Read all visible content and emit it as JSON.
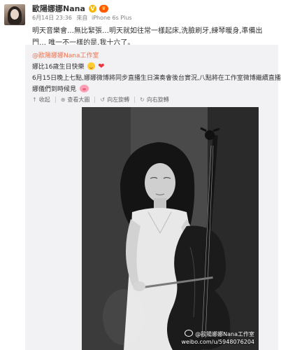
{
  "post": {
    "author": "歐陽娜娜Nana",
    "timestamp": "6月14日 23:36",
    "source_prefix": "來自",
    "source": "iPhone 6s Plus",
    "text": "明天音樂會…無比緊張…明天就如往常一樣起床,洗臉刷牙,練琴暖身,準備出門… 唯一不一樣的是,我十六了。"
  },
  "badges": {
    "verified_icon": "verified-badge-icon",
    "vip_icon": "vip-crown-icon",
    "verified_glyph": "V",
    "vip_glyph": "♛",
    "verified_color": "#f7b500",
    "vip_color": "#ff5a00"
  },
  "repost": {
    "author": "@歐陽娜娜Nana工作室",
    "lines": [
      "娜比16歲生日快樂",
      "6月15日晚上七點,娜娜微博將同步直播生日演奏會後台實況,八點將在工作室微博繼續直播!",
      "娜儀們到時候見"
    ],
    "author_color": "#eb7350",
    "background": "#f2f2f5"
  },
  "toolbar": {
    "collapse": "收起",
    "view_large": "查看大圖",
    "rotate_left": "向左旋轉",
    "rotate_right": "向右旋轉",
    "collapse_icon": "↑",
    "view_large_icon": "⊕",
    "rotate_left_icon": "↺",
    "rotate_right_icon": "↻"
  },
  "photo": {
    "watermark_user": "@歐陽娜娜Nana工作室",
    "watermark_url": "weibo.com/u/5948076204"
  }
}
